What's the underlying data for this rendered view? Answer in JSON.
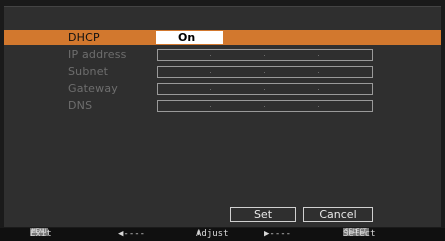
{
  "menu": {
    "rows": [
      {
        "label": "DHCP",
        "value": "On",
        "selected": true
      },
      {
        "label": "IP address",
        "value": ""
      },
      {
        "label": "Subnet",
        "value": ""
      },
      {
        "label": "Gateway",
        "value": ""
      },
      {
        "label": "DNS",
        "value": ""
      }
    ]
  },
  "buttons": {
    "set_label": "Set",
    "cancel_label": "Cancel"
  },
  "footer": {
    "menu_key": "MENU",
    "exit_label": "Exit",
    "left_icon": "◀",
    "left_label": "-----",
    "updown_icon": "⬍",
    "adjust_label": "Adjust",
    "right_icon": "▶",
    "right_label": "-----",
    "select_key": "SELECT",
    "select_label": "Select"
  },
  "colors": {
    "selected_row": "#d2782e",
    "background": "#2f2f2f"
  }
}
